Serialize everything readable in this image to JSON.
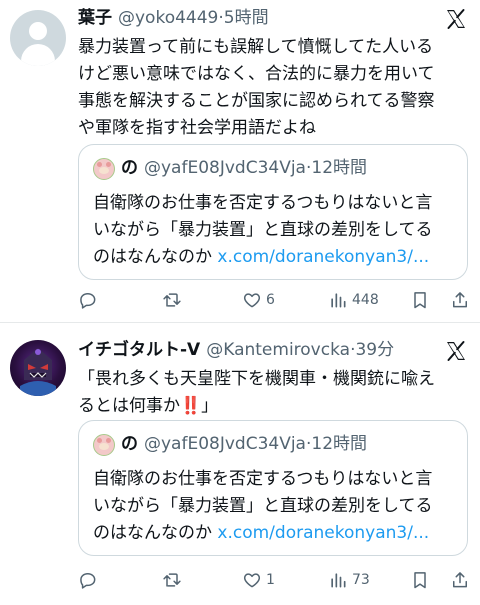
{
  "tweets": [
    {
      "author_name": "葉子",
      "handle": "@yoko4449",
      "time": "5時間",
      "text_lines": [
        "暴力装置って前にも誤解して憤慨してた人いる",
        "けど悪い意味ではなく、合法的に暴力を用いて",
        "事態を解決することが国家に認められてる警察",
        "や軍隊を指す社会学用語だよね"
      ],
      "quote": {
        "author_name": "の",
        "handle": "@yafE08JvdC34Vja",
        "time": "12時間",
        "text_lines": [
          "自衛隊のお仕事を否定するつもりはないと言",
          "いながら「暴力装置」と直球の差別をしてる",
          "のはなんなのか"
        ],
        "link": "x.com/doranekonyan3/..."
      },
      "actions": {
        "reply": "",
        "retweet": "",
        "like": "6",
        "views": "448"
      }
    },
    {
      "author_name": "イチゴタルト-V",
      "handle": "@Kantemirovcka",
      "time": "39分",
      "text_lines": [
        "「畏れ多くも天皇陛下を機関車・機関銃に喩え",
        "るとは何事か‼️」"
      ],
      "quote": {
        "author_name": "の",
        "handle": "@yafE08JvdC34Vja",
        "time": "12時間",
        "text_lines": [
          "自衛隊のお仕事を否定するつもりはないと言",
          "いながら「暴力装置」と直球の差別をしてる",
          "のはなんなのか"
        ],
        "link": "x.com/doranekonyan3/..."
      },
      "actions": {
        "reply": "",
        "retweet": "",
        "like": "1",
        "views": "73"
      }
    }
  ],
  "icons": [
    "x-logo-icon",
    "reply-icon",
    "retweet-icon",
    "like-icon",
    "views-icon",
    "bookmark-icon",
    "share-icon"
  ],
  "colors": {
    "text": "#0f1419",
    "secondary": "#536471",
    "link": "#1d9bf0",
    "border": "#cfd9de"
  }
}
